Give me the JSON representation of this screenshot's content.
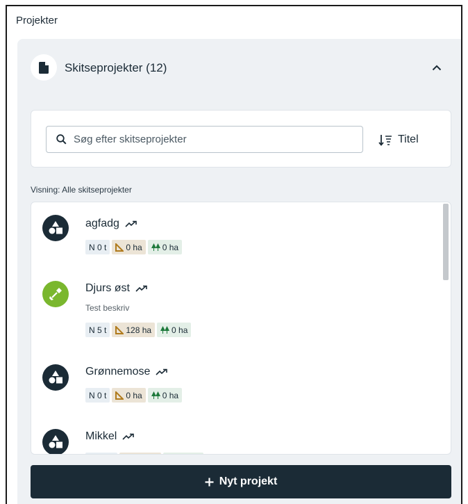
{
  "panel": {
    "title": "Projekter"
  },
  "section": {
    "title": "Skitseprojekter (12)"
  },
  "search": {
    "placeholder": "Søg efter skitseprojekter"
  },
  "sort": {
    "label": "Titel"
  },
  "view": {
    "label": "Visning: Alle skitseprojekter"
  },
  "projects": [
    {
      "name": "agfadg",
      "description": "",
      "n": "N 0 t",
      "area": "0 ha",
      "forest": "0 ha",
      "avatar": "dark"
    },
    {
      "name": "Djurs øst",
      "description": "Test beskriv",
      "n": "N 5 t",
      "area": "128 ha",
      "forest": "0 ha",
      "avatar": "green"
    },
    {
      "name": "Grønnemose",
      "description": "",
      "n": "N 0 t",
      "area": "0 ha",
      "forest": "0 ha",
      "avatar": "dark"
    },
    {
      "name": "Mikkel",
      "description": "",
      "n": "",
      "area": "",
      "forest": "",
      "avatar": "dark"
    }
  ],
  "actions": {
    "new_project": "Nyt projekt"
  },
  "colors": {
    "dark": "#1b2b36",
    "green": "#7ab72e",
    "background": "#eef1f4"
  }
}
